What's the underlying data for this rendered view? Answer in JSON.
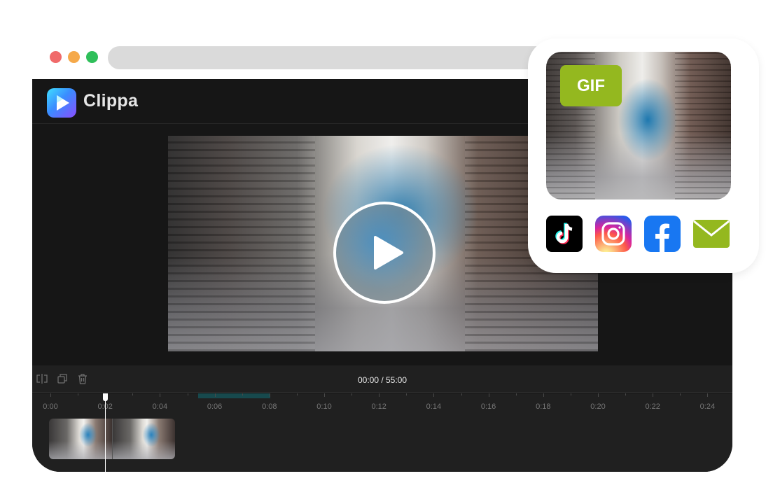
{
  "window": {
    "traffic_lights": [
      "#f06a6a",
      "#f5a94a",
      "#2fbf5a"
    ]
  },
  "app": {
    "brand": "Clippa",
    "accent": "#3a8cff"
  },
  "preview": {
    "play_icon": "play-icon"
  },
  "toolbar": {
    "timecode": "00:00 / 55:00",
    "tools": [
      "split-icon",
      "duplicate-icon",
      "trash-icon"
    ]
  },
  "timeline": {
    "ticks": [
      "0:00",
      "0:02",
      "0:04",
      "0:06",
      "0:08",
      "0:10",
      "0:12",
      "0:14",
      "0:16",
      "0:18",
      "0:20",
      "0:22",
      "0:24"
    ],
    "playhead_time": "0:02"
  },
  "share": {
    "gif_label": "GIF",
    "targets": [
      "tiktok-icon",
      "instagram-icon",
      "facebook-icon",
      "mail-icon"
    ],
    "badge_color": "#94b81f"
  }
}
